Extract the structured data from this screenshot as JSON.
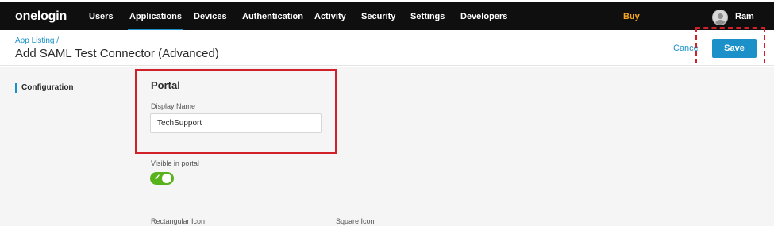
{
  "nav": {
    "logo": "onelogin",
    "items": [
      {
        "label": "Users",
        "active": false
      },
      {
        "label": "Applications",
        "active": true
      },
      {
        "label": "Devices",
        "active": false
      },
      {
        "label": "Authentication",
        "active": false
      },
      {
        "label": "Activity",
        "active": false
      },
      {
        "label": "Security",
        "active": false
      },
      {
        "label": "Settings",
        "active": false
      },
      {
        "label": "Developers",
        "active": false
      }
    ],
    "buy": "Buy",
    "user_name": "Ram",
    "avatar_icon": "user-avatar-icon"
  },
  "header": {
    "breadcrumb": "App Listing /",
    "title": "Add SAML Test Connector (Advanced)",
    "cancel_label": "Cance",
    "save_label": "Save"
  },
  "sidebar": {
    "items": [
      {
        "label": "Configuration",
        "active": true
      }
    ]
  },
  "portal": {
    "title": "Portal",
    "display_name_label": "Display Name",
    "display_name_value": "TechSupport",
    "visible_label": "Visible in portal",
    "visible_value": true,
    "check_icon": "check-icon",
    "rect_icon_label": "Rectangular Icon",
    "square_icon_label": "Square Icon"
  },
  "colors": {
    "nav_bg": "#0f0f0f",
    "accent": "#1c91c9",
    "buy": "#f5a623",
    "toggle_on": "#58b21b",
    "highlight": "#d0202a",
    "panel_bg": "#f5f5f5"
  }
}
